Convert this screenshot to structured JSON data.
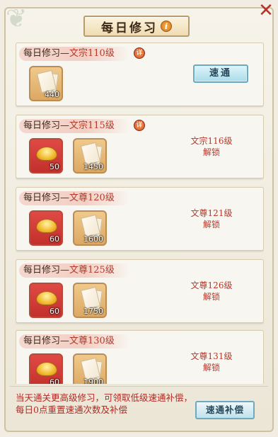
{
  "dialog": {
    "title": "每日修习",
    "info_glyph": "i",
    "close_glyph": "✕"
  },
  "cards": [
    {
      "prefix": "每日修习—",
      "rank": "文宗110级",
      "detail_glyph": "详",
      "items": [
        {
          "type": "paper",
          "qty": "440"
        }
      ],
      "action": "速通"
    },
    {
      "prefix": "每日修习—",
      "rank": "文宗115级",
      "detail_glyph": "详",
      "items": [
        {
          "type": "gold",
          "qty": "50"
        },
        {
          "type": "paper",
          "qty": "1450"
        }
      ],
      "unlock_line1": "文宗116级",
      "unlock_line2": "解锁"
    },
    {
      "prefix": "每日修习—",
      "rank": "文尊120级",
      "items": [
        {
          "type": "gold",
          "qty": "60"
        },
        {
          "type": "paper",
          "qty": "1600"
        }
      ],
      "unlock_line1": "文尊121级",
      "unlock_line2": "解锁"
    },
    {
      "prefix": "每日修习—",
      "rank": "文尊125级",
      "items": [
        {
          "type": "gold",
          "qty": "60"
        },
        {
          "type": "paper",
          "qty": "1750"
        }
      ],
      "unlock_line1": "文尊126级",
      "unlock_line2": "解锁"
    },
    {
      "prefix": "每日修习—",
      "rank": "文尊130级",
      "items": [
        {
          "type": "gold",
          "qty": "60"
        },
        {
          "type": "paper",
          "qty": "1900"
        }
      ],
      "unlock_line1": "文尊131级",
      "unlock_line2": "解锁"
    }
  ],
  "footer": {
    "note": "当天通关更高级修习，可领取低级速通补偿，每日0点重置速通次数及补偿",
    "compensation_button": "速通补偿"
  },
  "colors": {
    "accent_red": "#b33a2c",
    "button_blue": "#a9dbe9",
    "frame_bg": "#f6f3ea"
  }
}
